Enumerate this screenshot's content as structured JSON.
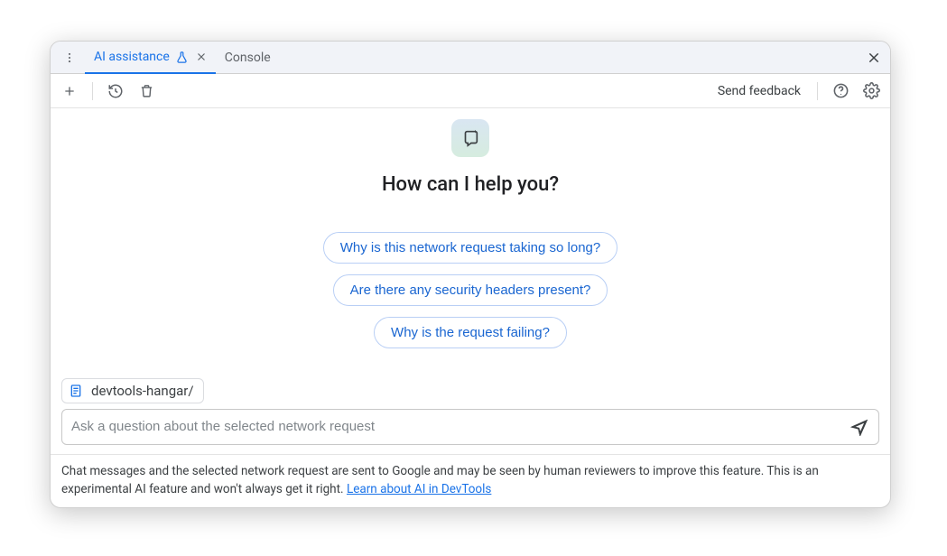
{
  "tabs": {
    "ai_assistance": "AI assistance",
    "console": "Console"
  },
  "toolbar": {
    "send_feedback": "Send feedback"
  },
  "hero": {
    "title": "How can I help you?"
  },
  "suggestions": [
    "Why is this network request taking so long?",
    "Are there any security headers present?",
    "Why is the request failing?"
  ],
  "context": {
    "label": "devtools-hangar/"
  },
  "input": {
    "placeholder": "Ask a question about the selected network request"
  },
  "footer": {
    "text_a": "Chat messages and the selected network request are sent to Google and may be seen by human reviewers to improve this feature. This is an experimental AI feature and won't always get it right. ",
    "link": "Learn about AI in DevTools"
  }
}
